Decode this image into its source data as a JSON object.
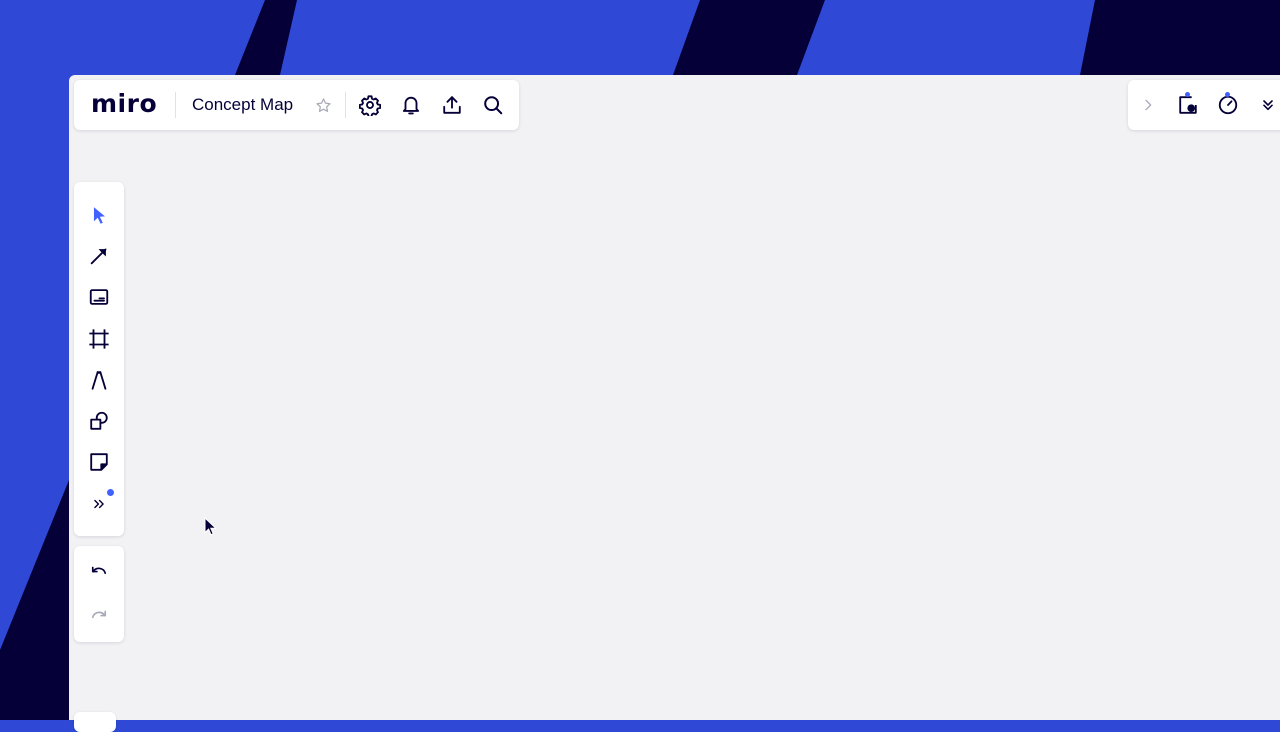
{
  "app": {
    "logo": "miro",
    "board_title": "Concept Map"
  },
  "colors": {
    "accent": "#4262ff",
    "ink": "#050038",
    "background_blue": "#2f49d6",
    "background_dark": "#050038",
    "canvas": "#f2f2f4",
    "disabled": "#a9aab8"
  },
  "topbar": {
    "icons": [
      "star-icon",
      "gear-icon",
      "bell-icon",
      "upload-icon",
      "search-icon"
    ]
  },
  "rightbar": {
    "icons": [
      "chevron-right-icon",
      "presentation-icon",
      "timer-icon",
      "chevron-double-down-icon"
    ]
  },
  "toolbar": {
    "tools": [
      "select",
      "connection-line",
      "text-card",
      "frame",
      "pen",
      "shapes",
      "sticky-note",
      "more-tools"
    ],
    "active_tool": "select",
    "more_tools_has_notification": true
  },
  "history": {
    "undo_enabled": true,
    "redo_enabled": false
  }
}
